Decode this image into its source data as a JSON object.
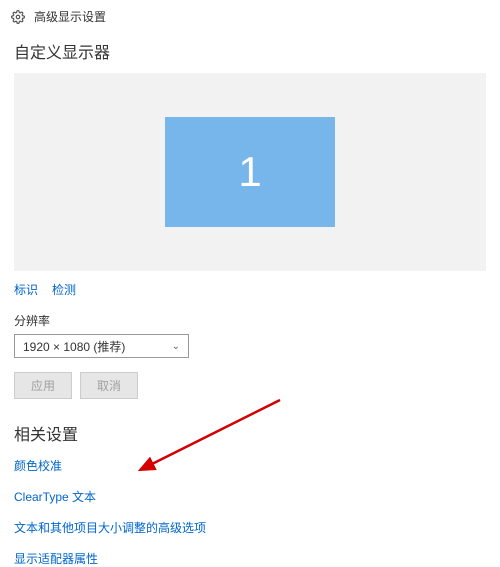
{
  "header": {
    "title": "高级显示设置"
  },
  "custom_display": {
    "heading": "自定义显示器",
    "monitor_number": "1",
    "identify_link": "标识",
    "detect_link": "检测"
  },
  "resolution": {
    "label": "分辨率",
    "selected": "1920 × 1080 (推荐)"
  },
  "buttons": {
    "apply": "应用",
    "cancel": "取消"
  },
  "related": {
    "heading": "相关设置",
    "links": [
      "颜色校准",
      "ClearType 文本",
      "文本和其他项目大小调整的高级选项",
      "显示适配器属性"
    ]
  }
}
